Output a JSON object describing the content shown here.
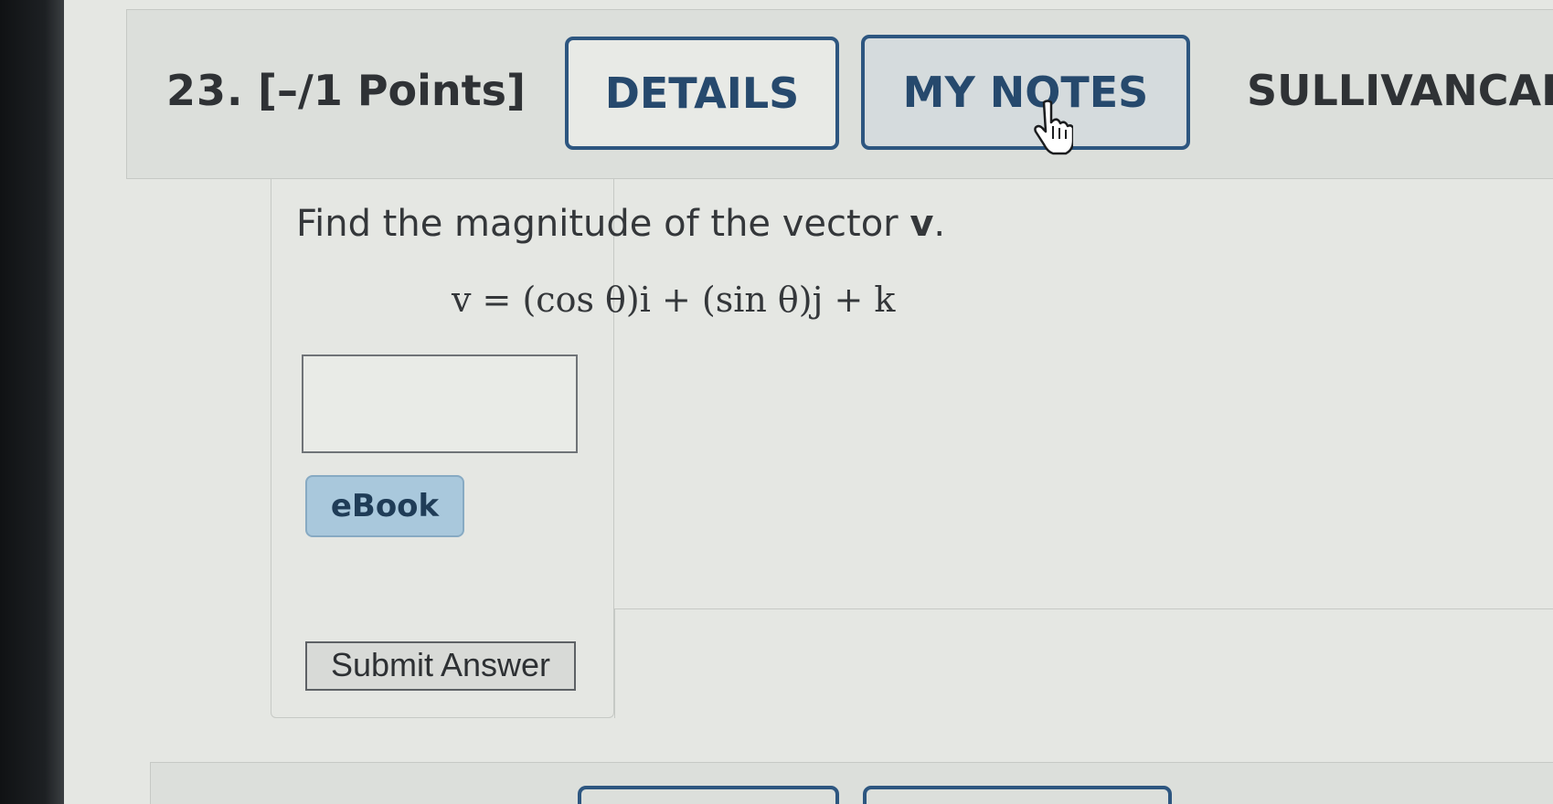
{
  "question": {
    "number": "23.",
    "points": "[–/1 Points]",
    "details_label": "DETAILS",
    "notes_label": "MY NOTES",
    "textbook_code": "SULLIVANCAL"
  },
  "problem": {
    "prompt_text": "Find the magnitude of the vector ",
    "prompt_vector": "v",
    "prompt_end": ".",
    "equation": "v = (cos θ)i + (sin θ)j + k"
  },
  "answer": {
    "value": ""
  },
  "buttons": {
    "ebook_label": "eBook",
    "submit_label": "Submit Answer"
  },
  "colors": {
    "accent": "#2d5680",
    "ebook": "#a9c8dc"
  },
  "icons": {
    "cursor": "hand-pointer-icon"
  }
}
